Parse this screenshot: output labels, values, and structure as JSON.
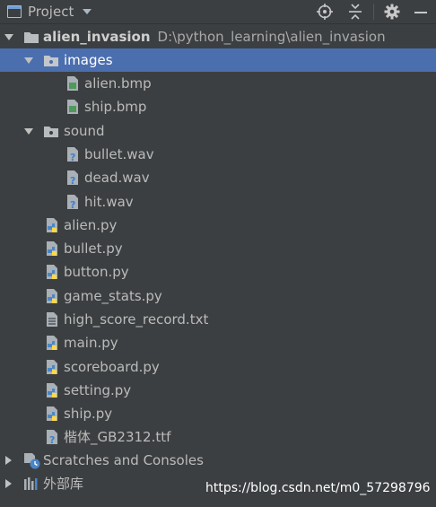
{
  "toolbar": {
    "title": "Project",
    "view_selector_icon": "chevron-down-icon",
    "icons": [
      "locate-icon",
      "collapse-all-icon",
      "gear-icon",
      "minimize-icon"
    ]
  },
  "tree": {
    "root": {
      "name": "alien_invasion",
      "path": "D:\\python_learning\\alien_invasion"
    },
    "images": {
      "name": "images",
      "files": [
        "alien.bmp",
        "ship.bmp"
      ]
    },
    "sound": {
      "name": "sound",
      "files": [
        "bullet.wav",
        "dead.wav",
        "hit.wav"
      ]
    },
    "files": [
      "alien.py",
      "bullet.py",
      "button.py",
      "game_stats.py",
      "high_score_record.txt",
      "main.py",
      "scoreboard.py",
      "setting.py",
      "ship.py",
      "楷体_GB2312.ttf"
    ],
    "scratches": "Scratches and Consoles",
    "external_libs": "外部库"
  },
  "watermark": "https://blog.csdn.net/m0_57298796",
  "colors": {
    "background": "#3c3f41",
    "selection": "#4b6eaf",
    "text": "#bbbbbb",
    "python_blue": "#4a86c8",
    "python_yellow": "#ffd845"
  }
}
